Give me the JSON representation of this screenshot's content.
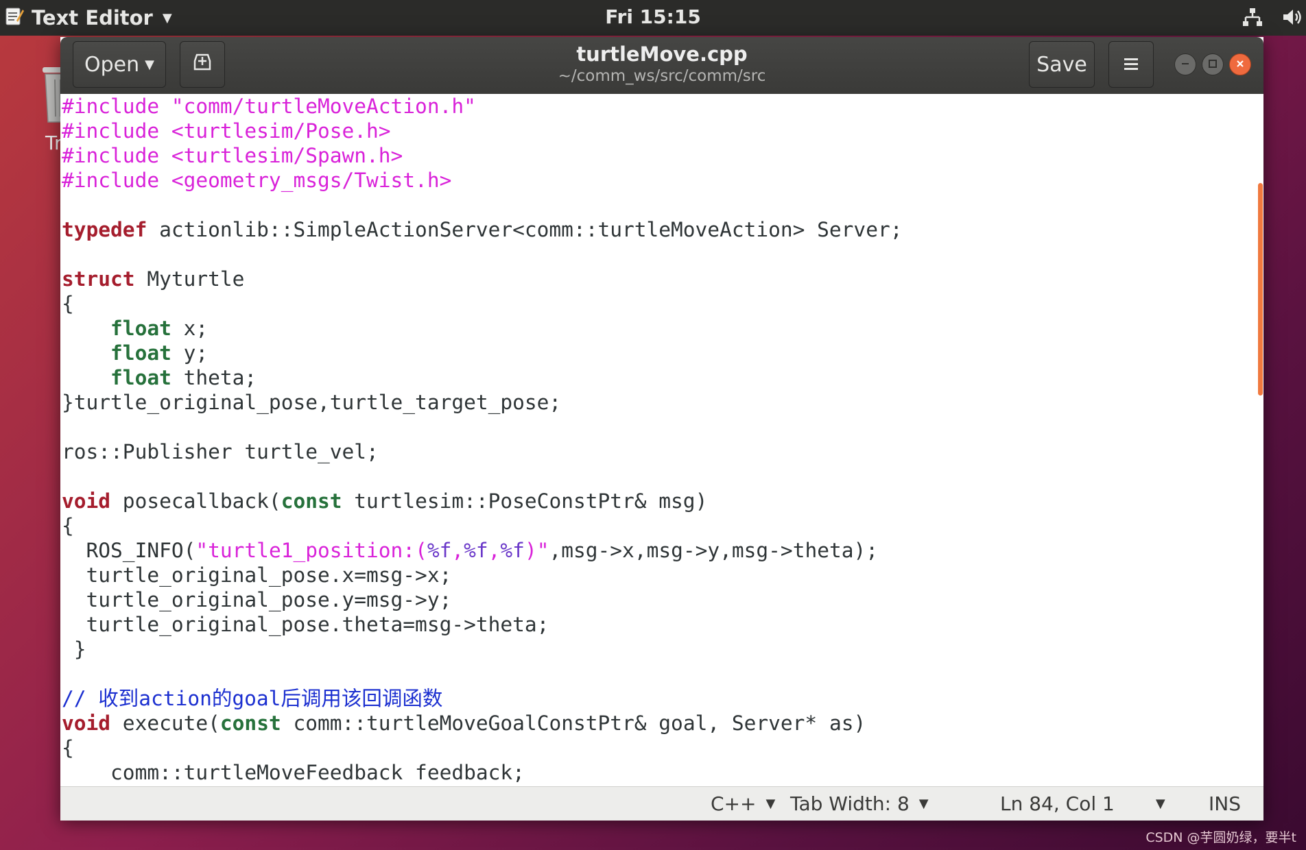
{
  "topbar": {
    "app_name": "Text Editor",
    "clock": "Fri 15:15",
    "icons": [
      "text-editor-icon",
      "network-icon",
      "volume-icon"
    ]
  },
  "desktop": {
    "trash_label": "Tr"
  },
  "window": {
    "title": "turtleMove.cpp",
    "subtitle": "~/comm_ws/src/comm/src",
    "open_label": "Open",
    "save_label": "Save"
  },
  "code_lines": [
    [
      [
        "pre",
        "#include \"comm/turtleMoveAction.h\""
      ]
    ],
    [
      [
        "pre",
        "#include <turtlesim/Pose.h>"
      ]
    ],
    [
      [
        "pre",
        "#include <turtlesim/Spawn.h>"
      ]
    ],
    [
      [
        "pre",
        "#include <geometry_msgs/Twist.h>"
      ]
    ],
    [],
    [
      [
        "kw",
        "typedef"
      ],
      [
        "",
        " actionlib::SimpleActionServer<comm::turtleMoveAction> Server;"
      ]
    ],
    [],
    [
      [
        "kw",
        "struct"
      ],
      [
        "",
        " Myturtle"
      ]
    ],
    [
      [
        "",
        "{"
      ]
    ],
    [
      [
        "",
        "    "
      ],
      [
        "ty",
        "float"
      ],
      [
        "",
        " x;"
      ]
    ],
    [
      [
        "",
        "    "
      ],
      [
        "ty",
        "float"
      ],
      [
        "",
        " y;"
      ]
    ],
    [
      [
        "",
        "    "
      ],
      [
        "ty",
        "float"
      ],
      [
        "",
        " theta;"
      ]
    ],
    [
      [
        "",
        "}turtle_original_pose,turtle_target_pose;"
      ]
    ],
    [],
    [
      [
        "",
        "ros::Publisher turtle_vel;"
      ]
    ],
    [],
    [
      [
        "kw",
        "void"
      ],
      [
        "",
        " posecallback("
      ],
      [
        "ty",
        "const"
      ],
      [
        "",
        " turtlesim::PoseConstPtr& msg)"
      ]
    ],
    [
      [
        "",
        "{"
      ]
    ],
    [
      [
        "",
        "  ROS_INFO("
      ],
      [
        "str",
        "\"turtle1_position:("
      ],
      [
        "fmt",
        "%f"
      ],
      [
        "str",
        ","
      ],
      [
        "fmt",
        "%f"
      ],
      [
        "str",
        ","
      ],
      [
        "fmt",
        "%f"
      ],
      [
        "str",
        ")\""
      ],
      [
        "",
        ",msg->x,msg->y,msg->theta);"
      ]
    ],
    [
      [
        "",
        "  turtle_original_pose.x=msg->x;"
      ]
    ],
    [
      [
        "",
        "  turtle_original_pose.y=msg->y;"
      ]
    ],
    [
      [
        "",
        "  turtle_original_pose.theta=msg->theta;"
      ]
    ],
    [
      [
        "",
        " }"
      ]
    ],
    [],
    [
      [
        "cm",
        "// 收到action的goal后调用该回调函数"
      ]
    ],
    [
      [
        "kw",
        "void"
      ],
      [
        "",
        " execute("
      ],
      [
        "ty",
        "const"
      ],
      [
        "",
        " comm::turtleMoveGoalConstPtr& goal, Server* as)"
      ]
    ],
    [
      [
        "",
        "{"
      ]
    ],
    [
      [
        "",
        "    comm::turtleMoveFeedback feedback;"
      ]
    ]
  ],
  "statusbar": {
    "language": "C++",
    "tab_width": "Tab Width: 8",
    "position": "Ln 84, Col 1",
    "mode": "INS"
  },
  "watermark": "CSDN @芋圆奶绿，要半t",
  "colors": {
    "preprocessor": "#d922d9",
    "keyword": "#a51d2d",
    "type": "#26713b",
    "comment": "#1b2fd0",
    "close_button": "#ef6a3e",
    "scroll_thumb": "#f0793f"
  }
}
